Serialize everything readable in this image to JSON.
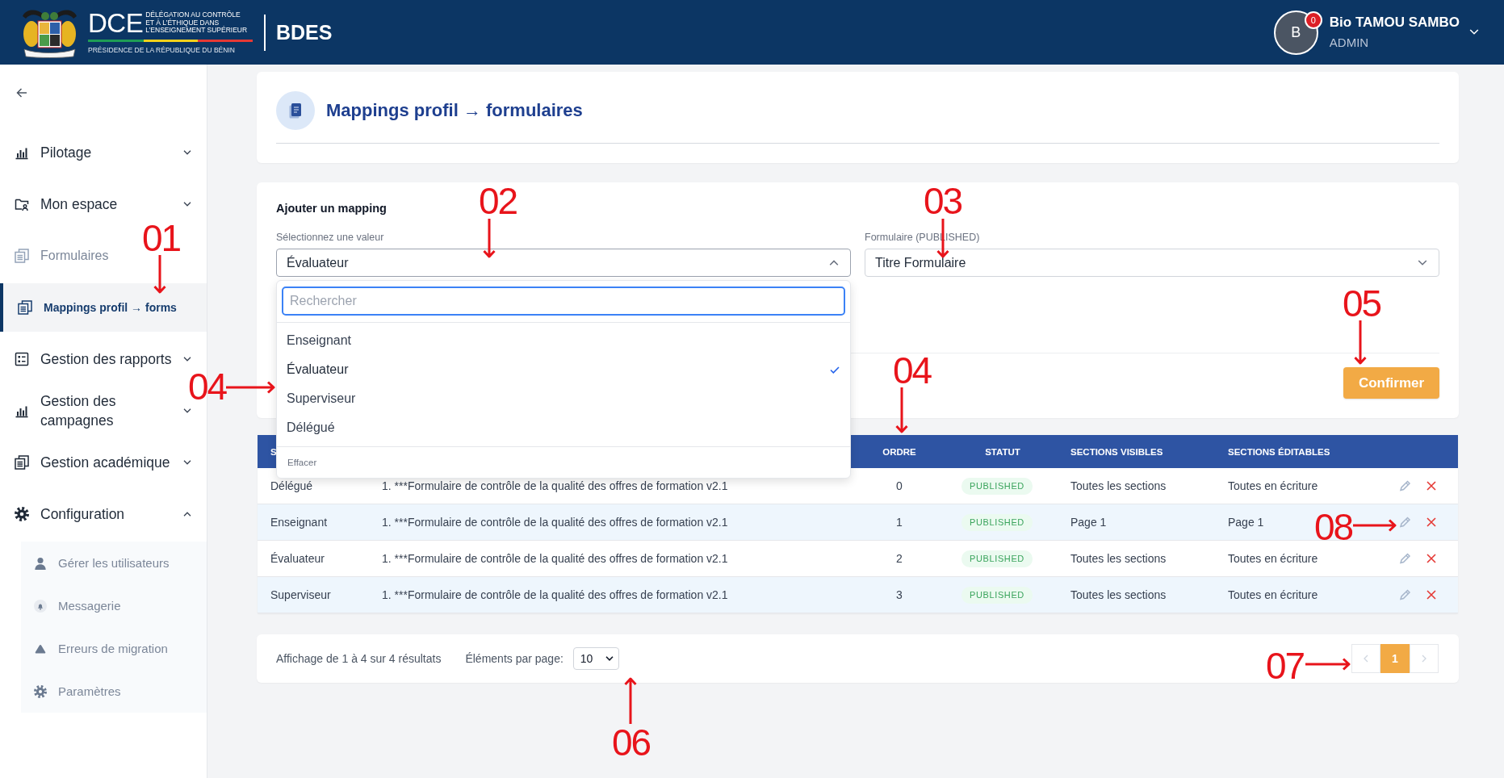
{
  "header": {
    "org_acronym": "DCE",
    "org_name_lines": [
      "DÉLÉGATION AU CONTRÔLE",
      "ET À L’ÉTHIQUE DANS",
      "L’ENSEIGNEMENT SUPÉRIEUR"
    ],
    "org_parent": "PRÉSIDENCE DE LA RÉPUBLIQUE DU BÉNIN",
    "app_name": "BDES",
    "user": {
      "initial": "B",
      "notifications": "0",
      "name": "Bio TAMOU SAMBO",
      "role": "ADMIN"
    }
  },
  "sidebar": {
    "items": [
      {
        "label": "Pilotage",
        "kind": "group",
        "expanded": false,
        "selected": false
      },
      {
        "label": "Mon espace",
        "kind": "group",
        "expanded": false,
        "selected": false
      },
      {
        "label": "Formulaires",
        "kind": "link",
        "selected": false
      },
      {
        "label": "Mappings profil → forms",
        "kind": "link",
        "selected": true
      },
      {
        "label": "Gestion des rapports",
        "kind": "group",
        "expanded": false,
        "selected": false
      },
      {
        "label": "Gestion des campagnes",
        "kind": "group",
        "expanded": false,
        "selected": false
      },
      {
        "label": "Gestion académique",
        "kind": "group",
        "expanded": false,
        "selected": false
      },
      {
        "label": "Configuration",
        "kind": "group",
        "expanded": true,
        "selected": false,
        "children": [
          {
            "label": "Gérer les utilisateurs",
            "selected": false
          },
          {
            "label": "Messagerie",
            "selected": false
          },
          {
            "label": "Erreurs de migration",
            "selected": false
          },
          {
            "label": "Paramètres",
            "selected": false
          }
        ]
      }
    ]
  },
  "page": {
    "title": "Mappings profil → formulaires"
  },
  "add_mapping": {
    "heading": "Ajouter un mapping",
    "fields": [
      {
        "label": "Sélectionnez une valeur",
        "value": "Évaluateur",
        "expanded": true,
        "menu": {
          "search": {
            "placeholder": "Rechercher"
          },
          "options": [
            {
              "label": "Enseignant",
              "selected": false
            },
            {
              "label": "Évaluateur",
              "selected": true
            },
            {
              "label": "Superviseur",
              "selected": false
            },
            {
              "label": "Délégué",
              "selected": false
            }
          ],
          "clear_label": "Effacer"
        }
      },
      {
        "label": "Formulaire (PUBLISHED)",
        "value": "Titre Formulaire",
        "expanded": false
      }
    ],
    "confirm_button": "Confirmer"
  },
  "table": {
    "columns": [
      {
        "label": "S"
      },
      {
        "label": "ORDRE"
      },
      {
        "label": "STATUT"
      },
      {
        "label": "SECTIONS VISIBLES"
      },
      {
        "label": "SECTIONS ÉDITABLES"
      }
    ],
    "rows": [
      {
        "profile": "Délégué",
        "form": "1. ***Formulaire de contrôle de la qualité des offres de formation v2.1",
        "order": "0",
        "status": "PUBLISHED",
        "visible_sections": "Toutes les sections",
        "editable_sections": "Toutes en écriture"
      },
      {
        "profile": "Enseignant",
        "form": "1. ***Formulaire de contrôle de la qualité des offres de formation v2.1",
        "order": "1",
        "status": "PUBLISHED",
        "visible_sections": "Page 1",
        "editable_sections": "Page 1"
      },
      {
        "profile": "Évaluateur",
        "form": "1. ***Formulaire de contrôle de la qualité des offres de formation v2.1",
        "order": "2",
        "status": "PUBLISHED",
        "visible_sections": "Toutes les sections",
        "editable_sections": "Toutes en écriture"
      },
      {
        "profile": "Superviseur",
        "form": "1. ***Formulaire de contrôle de la qualité des offres de formation v2.1",
        "order": "3",
        "status": "PUBLISHED",
        "visible_sections": "Toutes les sections",
        "editable_sections": "Toutes en écriture"
      }
    ]
  },
  "pagination": {
    "summary": "Affichage de 1 à 4 sur 4 résultats",
    "per_page_label": "Éléments par page:",
    "per_page_value": "10",
    "prev": {
      "disabled": true
    },
    "pages": [
      {
        "label": "1",
        "selected": true
      }
    ],
    "next": {
      "disabled": true
    }
  },
  "annotations": [
    {
      "label": "01",
      "kind": "down"
    },
    {
      "label": "02",
      "kind": "down"
    },
    {
      "label": "03",
      "kind": "down"
    },
    {
      "label": "04",
      "kind": "right"
    },
    {
      "label": "04",
      "kind": "down"
    },
    {
      "label": "05",
      "kind": "down"
    },
    {
      "label": "06",
      "kind": "up"
    },
    {
      "label": "07",
      "kind": "right"
    },
    {
      "label": "08",
      "kind": "right"
    }
  ]
}
